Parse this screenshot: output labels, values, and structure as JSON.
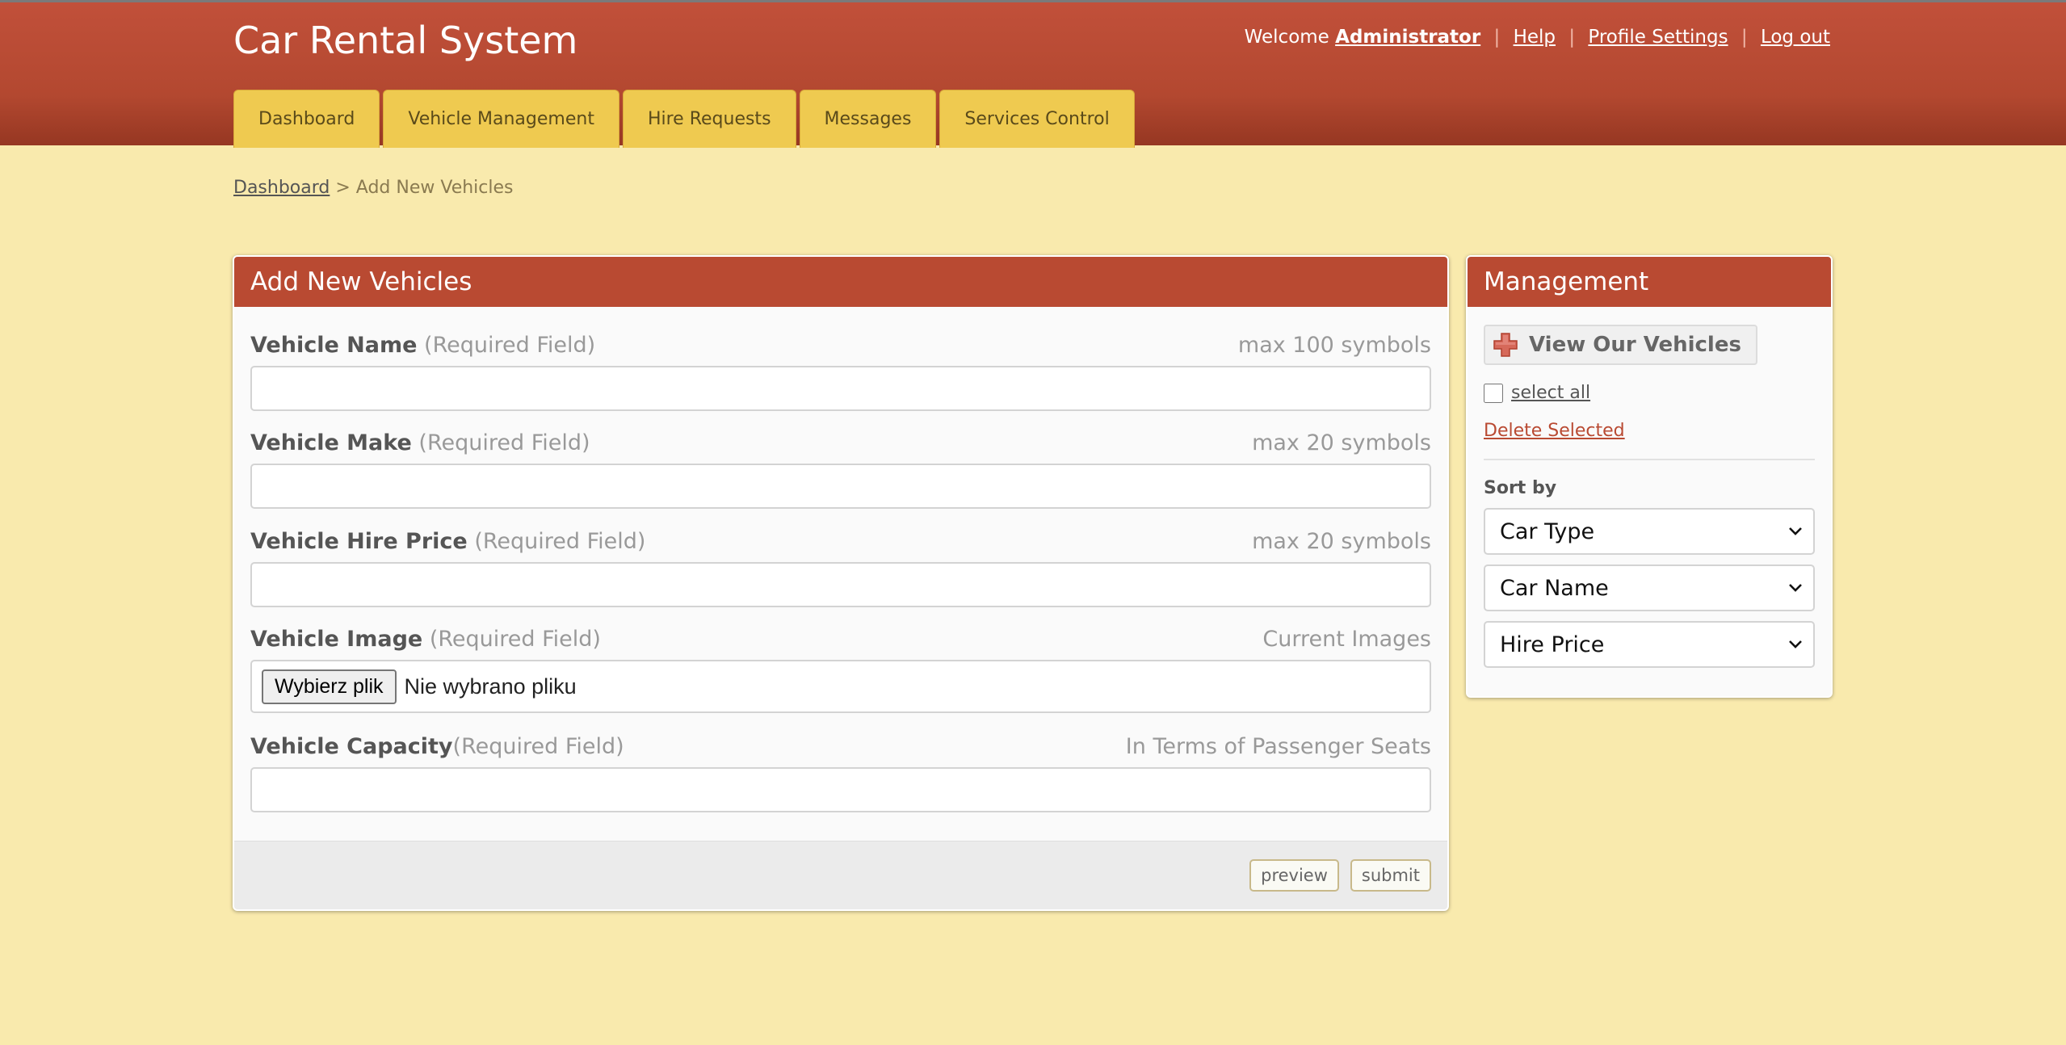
{
  "app": {
    "title": "Car Rental System"
  },
  "user_nav": {
    "welcome": "Welcome",
    "username": "Administrator",
    "help": "Help",
    "profile": "Profile Settings",
    "logout": "Log out",
    "separator": "|"
  },
  "tabs": [
    {
      "label": "Dashboard"
    },
    {
      "label": "Vehicle Management"
    },
    {
      "label": "Hire Requests"
    },
    {
      "label": "Messages"
    },
    {
      "label": "Services Control"
    }
  ],
  "breadcrumb": {
    "home": "Dashboard",
    "separator": ">",
    "current": "Add New Vehicles"
  },
  "form": {
    "title": "Add New Vehicles",
    "fields": [
      {
        "label": "Vehicle Name",
        "required": "(Required Field)",
        "hint": "max 100 symbols",
        "value": ""
      },
      {
        "label": "Vehicle Make",
        "required": "(Required Field)",
        "hint": "max 20 symbols",
        "value": ""
      },
      {
        "label": "Vehicle Hire Price",
        "required": "(Required Field)",
        "hint": "max 20 symbols",
        "value": ""
      },
      {
        "label": "Vehicle Image",
        "required": "(Required Field)",
        "hint": "Current Images",
        "file_button": "Wybierz plik",
        "file_status": "Nie wybrano pliku"
      },
      {
        "label": "Vehicle Capacity",
        "required": "(Required Field)",
        "hint": "In Terms of Passenger Seats",
        "value": ""
      }
    ],
    "preview_label": "preview",
    "submit_label": "submit"
  },
  "management": {
    "title": "Management",
    "view_button": "View Our Vehicles",
    "view_icon": "plus-icon",
    "select_all": "select all",
    "select_all_checked": false,
    "delete_selected": "Delete Selected",
    "sort_label": "Sort by",
    "sort_options": [
      "Car Type",
      "Car Name",
      "Hire Price"
    ]
  },
  "colors": {
    "header": "#b94a32",
    "background": "#f9eaad",
    "tab": "#efca50",
    "link_accent": "#b94a32"
  }
}
